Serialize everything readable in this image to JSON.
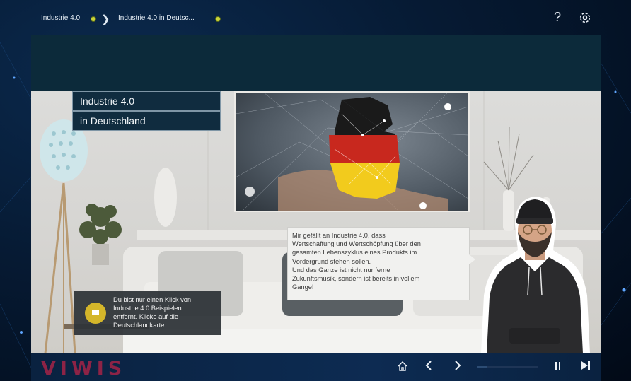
{
  "breadcrumb": {
    "item1": "Industrie 4.0",
    "item2": "Industrie 4.0 in Deutsc..."
  },
  "icons": {
    "help": "?",
    "settings": "gear-icon",
    "home": "home-icon",
    "prev": "chevron-left-icon",
    "next": "chevron-right-icon",
    "pause": "pause-icon",
    "skip": "skip-next-icon",
    "hint": "message-icon"
  },
  "title": {
    "line1": "Industrie 4.0",
    "line2": "in Deutschland"
  },
  "speech": [
    "Mir gefällt an Industrie 4.0, dass",
    "Wertschaffung und Wertschöpfung über den",
    "gesamten Lebenszyklus eines Produkts im",
    "Vordergrund stehen sollen.",
    "Und das Ganze ist nicht nur ferne",
    "Zukunftsmusik, sondern ist bereits in vollem",
    "Gange!"
  ],
  "hint": [
    "Du bist nur einen Klick von",
    "Industrie 4.0 Beispielen",
    "entfernt. Klicke auf die",
    "Deutschlandkarte."
  ],
  "footer": {
    "brand": "VIWIS",
    "progress_fraction": 0.15
  },
  "colors": {
    "accent_yellow": "#d4b62a",
    "brand": "#8d2346",
    "header": "#0c2a3a",
    "flag_black": "#1a1a1a",
    "flag_red": "#c8281e",
    "flag_gold": "#f2cb1d"
  }
}
